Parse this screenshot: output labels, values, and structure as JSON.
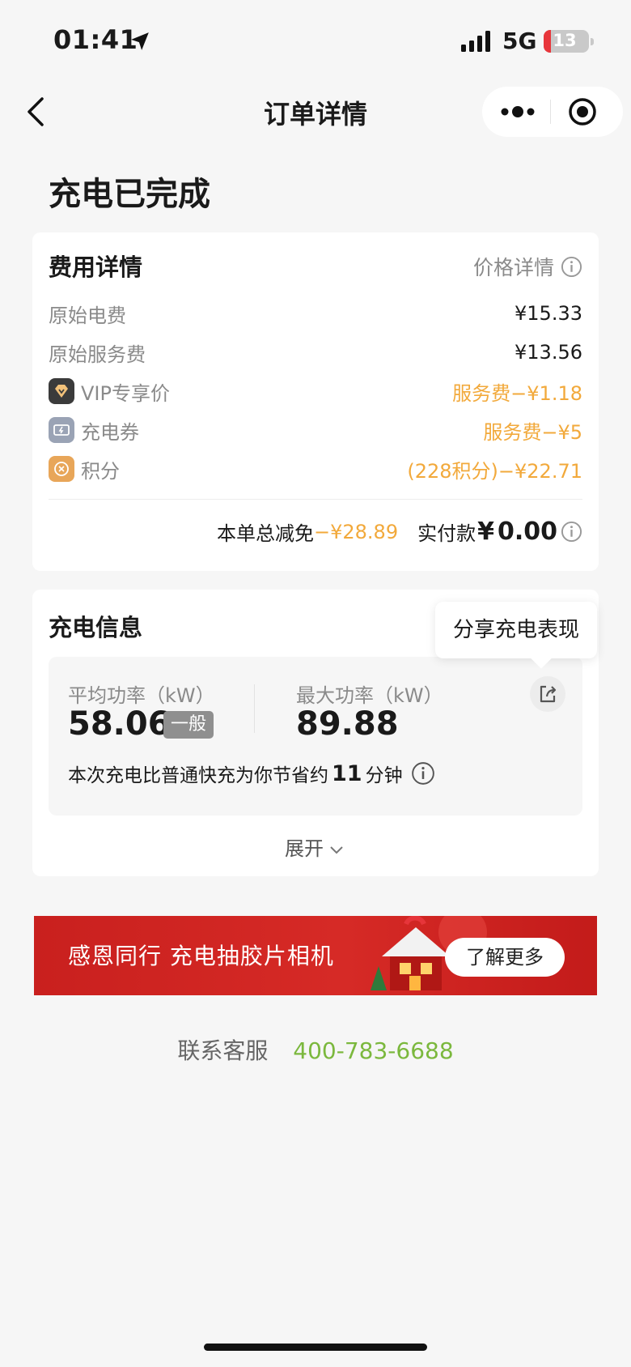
{
  "status_bar": {
    "time": "01:41",
    "network": "5G",
    "battery": "13"
  },
  "nav": {
    "title": "订单详情"
  },
  "page": {
    "title": "充电已完成"
  },
  "fee": {
    "title": "费用详情",
    "price_details_link": "价格详情",
    "rows": [
      {
        "label": "原始电费",
        "value": "¥15.33"
      },
      {
        "label": "原始服务费",
        "value": "¥13.56"
      },
      {
        "label": "VIP专享价",
        "value": "服务费−¥1.18",
        "icon": "vip-diamond-icon"
      },
      {
        "label": "充电券",
        "value": "服务费−¥5",
        "icon": "coupon-icon"
      },
      {
        "label": "积分",
        "value": "(228积分)−¥22.71",
        "icon": "points-icon"
      }
    ],
    "total_discount_label": "本单总减免",
    "total_discount_value": "−¥28.89",
    "paid_label": "实付款",
    "paid_currency": "¥",
    "paid_value": "0.00"
  },
  "charge": {
    "title": "充电信息",
    "avg_power_label": "平均功率（kW）",
    "avg_power_value": "58.06",
    "avg_power_tag": "一般",
    "max_power_label": "最大功率（kW）",
    "max_power_value": "89.88",
    "save_prefix": "本次充电比普通快充为你节省约",
    "save_minutes": "11",
    "save_suffix": "分钟",
    "expand_label": "展开"
  },
  "tooltip": {
    "text": "分享充电表现"
  },
  "banner": {
    "text": "感恩同行 充电抽胶片相机",
    "cta": "了解更多"
  },
  "contact": {
    "label": "联系客服",
    "phone": "400-783-6688"
  },
  "colors": {
    "orange": "#f2a93b",
    "green": "#7bb83d",
    "banner_red": "#d62a26"
  }
}
